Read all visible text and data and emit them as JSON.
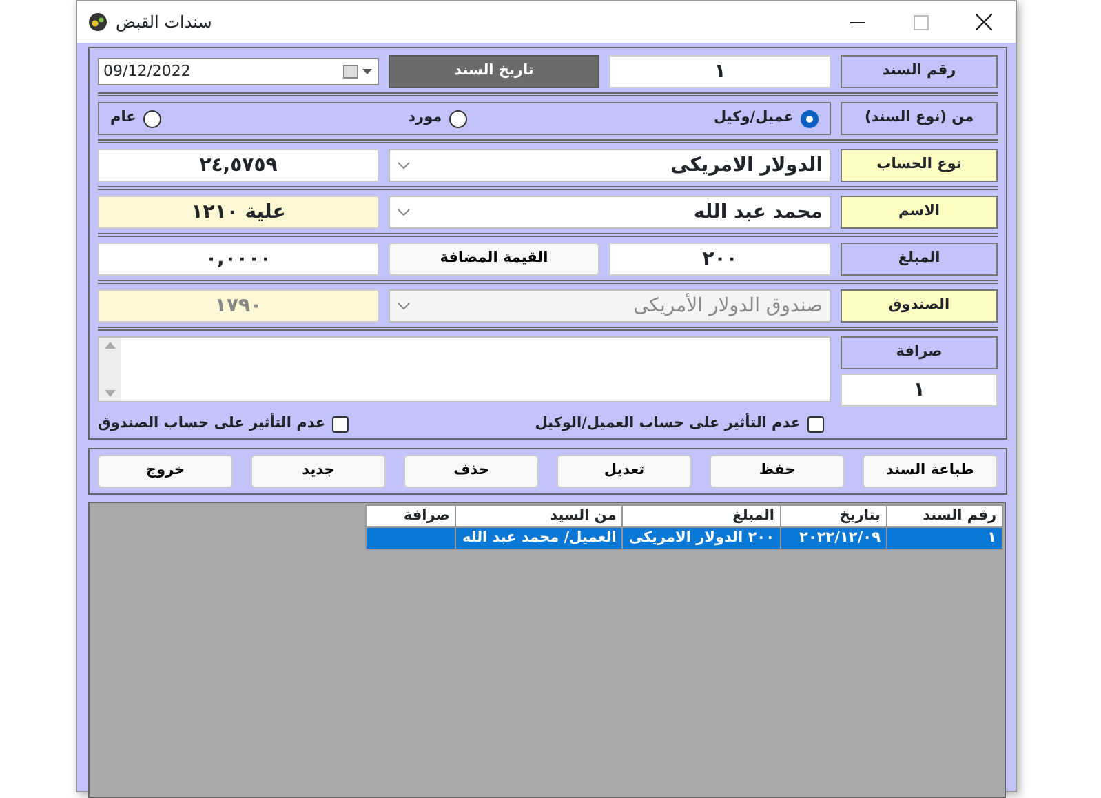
{
  "window": {
    "title": "سندات القبض"
  },
  "voucher_number": {
    "label": "رقم السند",
    "value": "١"
  },
  "date": {
    "button": "تاريخ السند",
    "value": "09/12/2022"
  },
  "voucher_type": {
    "label": "من (نوع السند)",
    "options": [
      {
        "label": "عميل/وكيل",
        "selected": true
      },
      {
        "label": "مورد",
        "selected": false
      },
      {
        "label": "عام",
        "selected": false
      }
    ]
  },
  "account_type": {
    "label": "نوع الحساب",
    "value": "الدولار الامريكى",
    "rate": "٢٤,٥٧٥٩"
  },
  "name": {
    "label": "الاسم",
    "value": "محمد عبد الله",
    "balance": "علية ١٢١٠"
  },
  "amount": {
    "label": "المبلغ",
    "value": "٢٠٠",
    "vat_button": "القيمة المضافة",
    "vat_value": "٠,٠٠٠٠"
  },
  "cashbox": {
    "label": "الصندوق",
    "value": "صندوق الدولار الأمريكى",
    "balance": "١٧٩٠",
    "disabled": true
  },
  "exchange": {
    "label": "صرافة",
    "value": "١"
  },
  "checkboxes": [
    {
      "label": "عدم التأثير على حساب العميل/الوكيل",
      "checked": false
    },
    {
      "label": "عدم التأثير على حساب الصندوق",
      "checked": false
    }
  ],
  "buttons": [
    "طباعة السند",
    "حفظ",
    "تعديل",
    "حذف",
    "جديد",
    "خروج"
  ],
  "table": {
    "columns": [
      "رقم السند",
      "بتاريخ",
      "المبلغ",
      "من السيد",
      "صرافة"
    ],
    "rows": [
      {
        "cells": [
          "١",
          "٢٠٢٢/١٢/٠٩",
          "٢٠٠ الدولار الامريكى",
          "العميل/ محمد عبد الله",
          ""
        ],
        "selected": true
      }
    ]
  }
}
